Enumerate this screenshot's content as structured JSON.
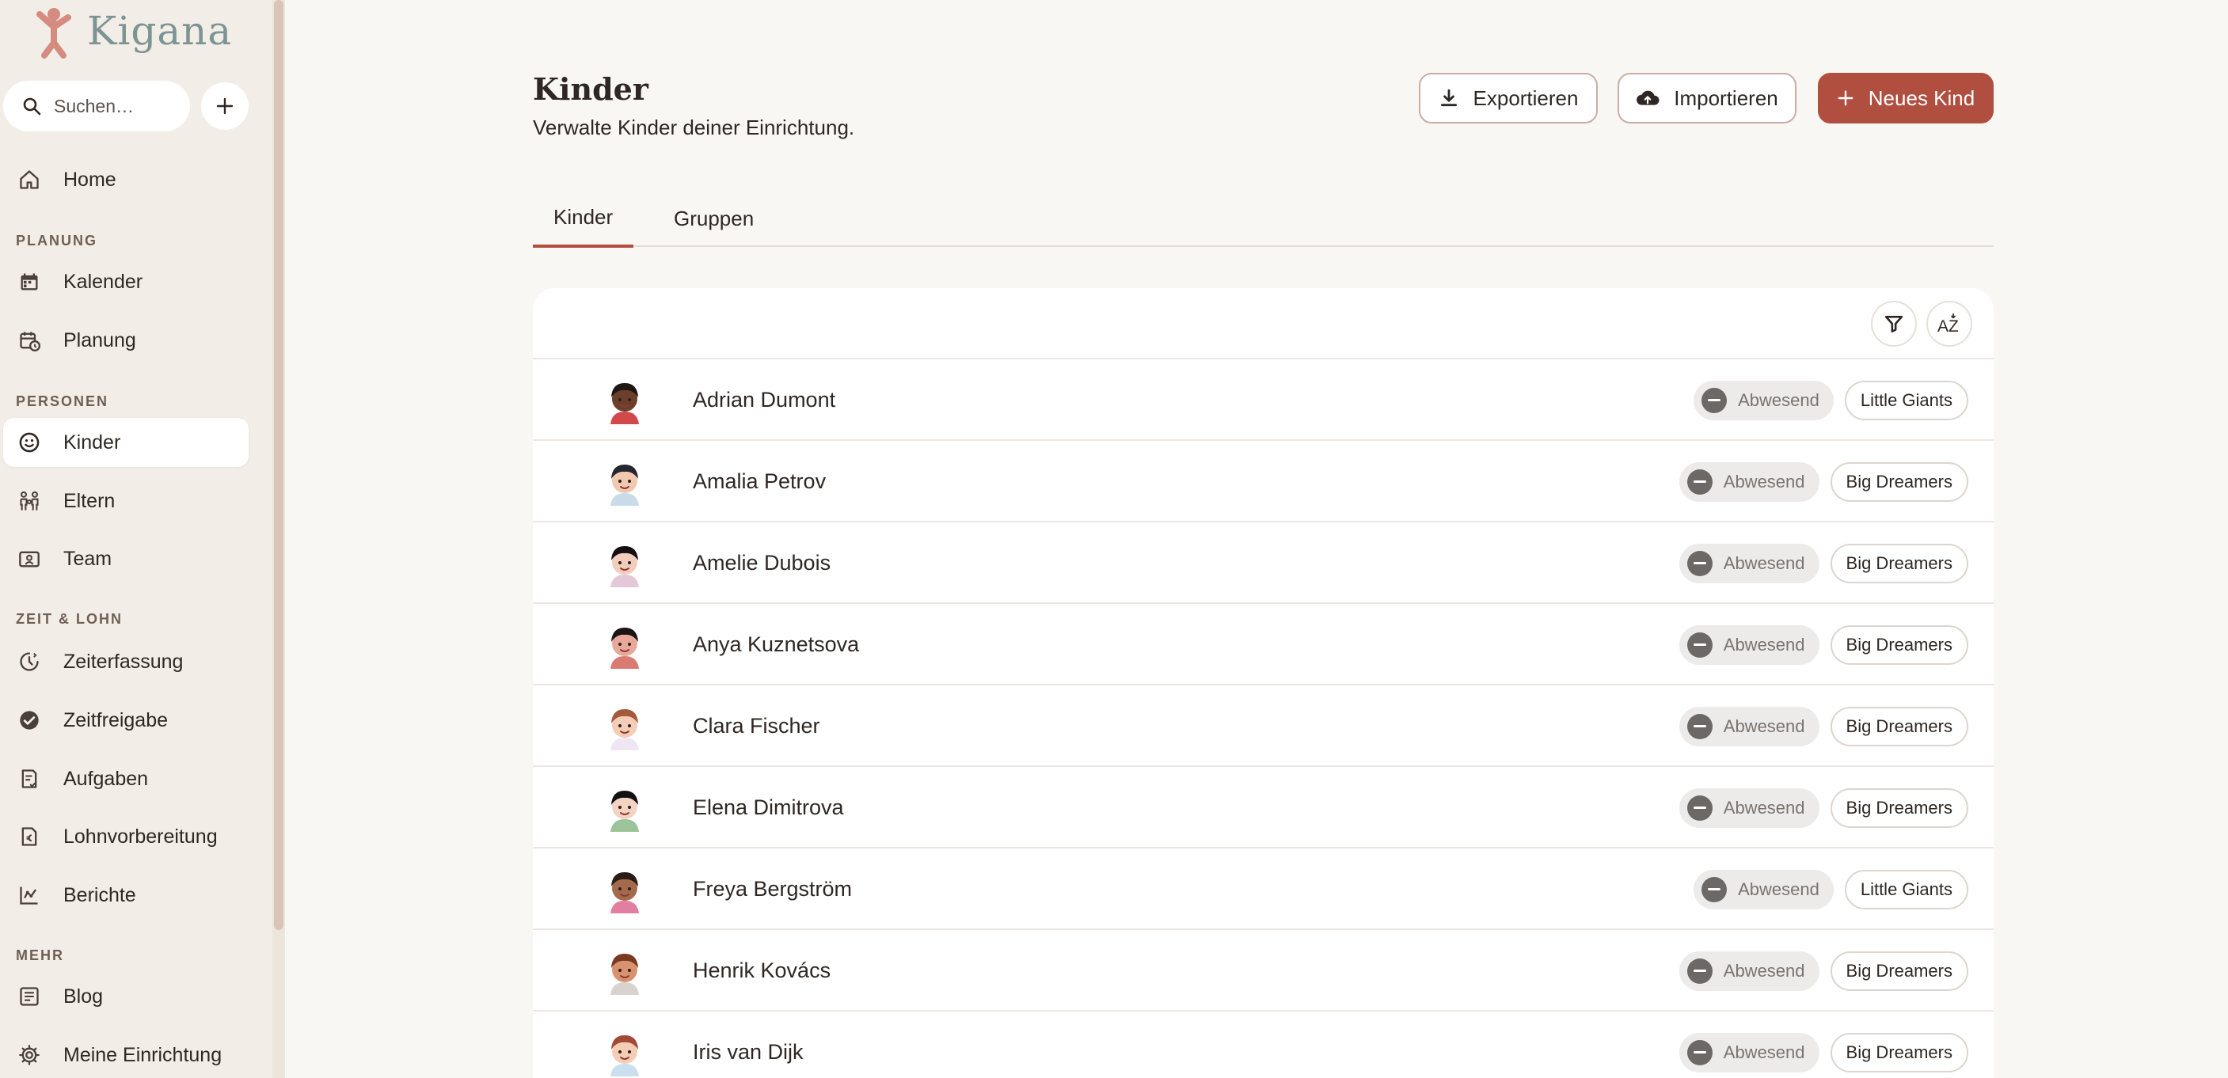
{
  "brand": {
    "name": "Kigana",
    "logo_color": "#d58b7f",
    "text_color": "#7c9494"
  },
  "search": {
    "placeholder": "Suchen…"
  },
  "sidebar": {
    "items_top": [
      {
        "label": "Home",
        "icon": "home-icon"
      }
    ],
    "sections": [
      {
        "label": "PLANUNG",
        "items": [
          {
            "label": "Kalender",
            "icon": "calendar-icon"
          },
          {
            "label": "Planung",
            "icon": "calendar-clock-icon"
          }
        ]
      },
      {
        "label": "PERSONEN",
        "items": [
          {
            "label": "Kinder",
            "icon": "smiley-icon",
            "active": true
          },
          {
            "label": "Eltern",
            "icon": "family-icon"
          },
          {
            "label": "Team",
            "icon": "id-card-icon"
          }
        ]
      },
      {
        "label": "ZEIT & LOHN",
        "items": [
          {
            "label": "Zeiterfassung",
            "icon": "clock-icon"
          },
          {
            "label": "Zeitfreigabe",
            "icon": "check-circle-icon"
          },
          {
            "label": "Aufgaben",
            "icon": "task-icon"
          },
          {
            "label": "Lohnvorbereitung",
            "icon": "euro-doc-icon"
          },
          {
            "label": "Berichte",
            "icon": "chart-icon"
          }
        ]
      },
      {
        "label": "MEHR",
        "items": [
          {
            "label": "Blog",
            "icon": "blog-icon"
          },
          {
            "label": "Meine Einrichtung",
            "icon": "gear-icon"
          }
        ]
      }
    ]
  },
  "page": {
    "title": "Kinder",
    "subtitle": "Verwalte Kinder deiner Einrichtung.",
    "buttons": {
      "export": "Exportieren",
      "import": "Importieren",
      "new": "Neues Kind"
    }
  },
  "tabs": [
    {
      "label": "Kinder",
      "active": true
    },
    {
      "label": "Gruppen",
      "active": false
    }
  ],
  "toolbar": {
    "sort_label": "AZ"
  },
  "children": [
    {
      "name": "Adrian Dumont",
      "status": "Abwesend",
      "group": "Little Giants",
      "skin": "#6b3f2a",
      "hair": "#1e1612",
      "shirt": "#d1494a"
    },
    {
      "name": "Amalia Petrov",
      "status": "Abwesend",
      "group": "Big Dreamers",
      "skin": "#f1c9b0",
      "hair": "#26262e",
      "shirt": "#c9dbe8"
    },
    {
      "name": "Amelie Dubois",
      "status": "Abwesend",
      "group": "Big Dreamers",
      "skin": "#f3cdbb",
      "hair": "#141014",
      "shirt": "#e3c8d8"
    },
    {
      "name": "Anya Kuznetsova",
      "status": "Abwesend",
      "group": "Big Dreamers",
      "skin": "#e9a99a",
      "hair": "#1b1515",
      "shirt": "#d97b73"
    },
    {
      "name": "Clara Fischer",
      "status": "Abwesend",
      "group": "Big Dreamers",
      "skin": "#f4cdb7",
      "hair": "#a45a3e",
      "shirt": "#efe6f4"
    },
    {
      "name": "Elena Dimitrova",
      "status": "Abwesend",
      "group": "Big Dreamers",
      "skin": "#f3d3c2",
      "hair": "#111113",
      "shirt": "#9cc49a"
    },
    {
      "name": "Freya Bergström",
      "status": "Abwesend",
      "group": "Little Giants",
      "skin": "#a46a4e",
      "hair": "#2a1c16",
      "shirt": "#e27fa0"
    },
    {
      "name": "Henrik Kovács",
      "status": "Abwesend",
      "group": "Big Dreamers",
      "skin": "#d9926f",
      "hair": "#7a3a22",
      "shirt": "#d8d3cf"
    },
    {
      "name": "Iris van Dijk",
      "status": "Abwesend",
      "group": "Big Dreamers",
      "skin": "#f4cdb7",
      "hair": "#a24a35",
      "shirt": "#cbe0ef"
    }
  ]
}
